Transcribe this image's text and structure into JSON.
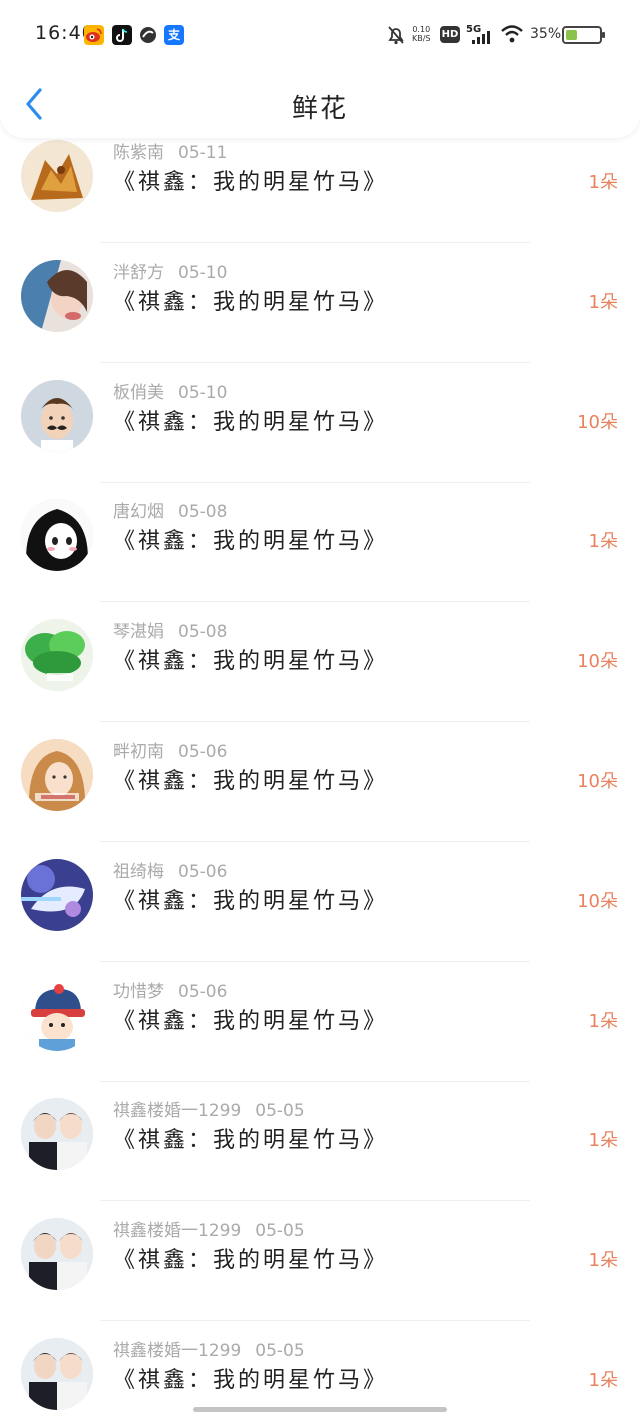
{
  "status_bar": {
    "time": "16:40",
    "apps": [
      "weibo-icon",
      "tiktok-icon",
      "circle-app-icon",
      "alipay-icon"
    ],
    "alipay_glyph": "支",
    "net_speed_value": "0.10",
    "net_speed_unit": "KB/S",
    "hd": "HD",
    "network": "5G",
    "battery_percent": "35%"
  },
  "header": {
    "title": "鲜花"
  },
  "colors": {
    "accent_blue": "#2a8cf0",
    "count_orange": "#e8835e",
    "meta_gray": "#aaaaaa"
  },
  "items": [
    {
      "name": "陈紫南",
      "date": "05-11",
      "book": "《祺鑫：我的明星竹马》",
      "count": "1朵",
      "avatar": "dragon"
    },
    {
      "name": "泮舒方",
      "date": "05-10",
      "book": "《祺鑫：我的明星竹马》",
      "count": "1朵",
      "avatar": "girl-photo"
    },
    {
      "name": "板俏美",
      "date": "05-10",
      "book": "《祺鑫：我的明星竹马》",
      "count": "10朵",
      "avatar": "boy-mustache"
    },
    {
      "name": "唐幻烟",
      "date": "05-08",
      "book": "《祺鑫：我的明星竹马》",
      "count": "1朵",
      "avatar": "anime-girl"
    },
    {
      "name": "琴湛娟",
      "date": "05-08",
      "book": "《祺鑫：我的明星竹马》",
      "count": "10朵",
      "avatar": "green-leaves"
    },
    {
      "name": "畔初南",
      "date": "05-06",
      "book": "《祺鑫：我的明星竹马》",
      "count": "10朵",
      "avatar": "girl-warm"
    },
    {
      "name": "祖绮梅",
      "date": "05-06",
      "book": "《祺鑫：我的明星竹马》",
      "count": "10朵",
      "avatar": "fantasy-art"
    },
    {
      "name": "功惜梦",
      "date": "05-06",
      "book": "《祺鑫：我的明星竹马》",
      "count": "1朵",
      "avatar": "cartoon-qing"
    },
    {
      "name": "祺鑫楼婚一1299",
      "date": "05-05",
      "book": "《祺鑫：我的明星竹马》",
      "count": "1朵",
      "avatar": "two-boys"
    },
    {
      "name": "祺鑫楼婚一1299",
      "date": "05-05",
      "book": "《祺鑫：我的明星竹马》",
      "count": "1朵",
      "avatar": "two-boys"
    },
    {
      "name": "祺鑫楼婚一1299",
      "date": "05-05",
      "book": "《祺鑫：我的明星竹马》",
      "count": "1朵",
      "avatar": "two-boys"
    }
  ]
}
